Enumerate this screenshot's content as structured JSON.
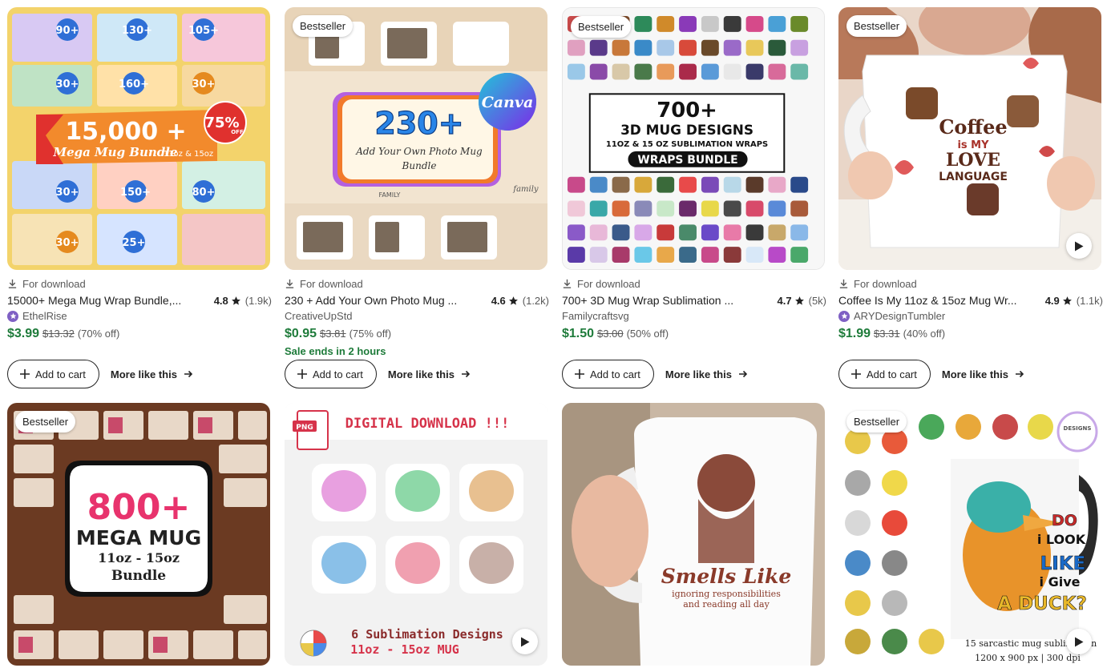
{
  "listings": [
    {
      "download_label": "For download",
      "title": "15000+ Mega Mug Wrap Bundle,...",
      "rating": "4.8",
      "reviews": "(1.9k)",
      "shop": "EthelRise",
      "star_seller": true,
      "price": "$3.99",
      "original_price": "$13.32",
      "discount": "(70% off)",
      "cart_label": "Add to cart",
      "more_label": "More like this",
      "art": {
        "headline": "15,000 +",
        "sub": "Mega Mug Bundle",
        "size": "11oz & 15oz",
        "stamp": "75%",
        "stamp_sub": "OFF",
        "tiles": [
          "90+",
          "130+",
          "105+",
          "30+",
          "160+",
          "30+",
          "30+",
          "150+",
          "80+",
          "30+",
          "25+"
        ]
      }
    },
    {
      "badge": "Bestseller",
      "download_label": "For download",
      "title": "230 + Add Your Own Photo Mug ...",
      "rating": "4.6",
      "reviews": "(1.2k)",
      "shop": "CreativeUpStd",
      "star_seller": false,
      "price": "$0.95",
      "original_price": "$3.81",
      "discount": "(75% off)",
      "sale_note": "Sale ends in 2 hours",
      "cart_label": "Add to cart",
      "more_label": "More like this",
      "art": {
        "headline": "230+",
        "line1": "Add Your Own Photo Mug",
        "line2": "Bundle",
        "logo": "Canva",
        "mug_word": "FAMILY",
        "mug_script": "family"
      }
    },
    {
      "badge": "Bestseller",
      "download_label": "For download",
      "title": "700+ 3D Mug Wrap Sublimation ...",
      "rating": "4.7",
      "reviews": "(5k)",
      "shop": "Familycraftsvg",
      "star_seller": false,
      "price": "$1.50",
      "original_price": "$3.00",
      "discount": "(50% off)",
      "cart_label": "Add to cart",
      "more_label": "More like this",
      "art": {
        "headline": "700+",
        "line1": "3D MUG DESIGNS",
        "line2": "11OZ & 15 OZ SUBLIMATION WRAPS",
        "line3": "WRAPS BUNDLE"
      }
    },
    {
      "badge": "Bestseller",
      "download_label": "For download",
      "title": "Coffee Is My 11oz & 15oz Mug Wr...",
      "rating": "4.9",
      "reviews": "(1.1k)",
      "shop": "ARYDesignTumbler",
      "star_seller": true,
      "price": "$1.99",
      "original_price": "$3.31",
      "discount": "(40% off)",
      "cart_label": "Add to cart",
      "more_label": "More like this",
      "video": true,
      "art": {
        "line1": "Coffee",
        "line2": "is MY",
        "line3": "LOVE",
        "line4": "LANGUAGE"
      }
    },
    {
      "badge": "Bestseller",
      "art": {
        "headline": "800+",
        "line1": "MEGA MUG",
        "line2": "11oz - 15oz",
        "line3": "Bundle"
      }
    },
    {
      "art": {
        "header": "DIGITAL DOWNLOAD !!!",
        "file": "PNG",
        "line1": "6 Sublimation Designs",
        "line2": "11oz - 15oz MUG"
      },
      "video": true
    },
    {
      "art": {
        "line1": "Smells Like",
        "line2": "ignoring responsibilities",
        "line3": "and reading all day"
      }
    },
    {
      "badge": "Bestseller",
      "video": true,
      "art": {
        "line1": "DO",
        "line2": "i LOOK",
        "line3": "LIKE",
        "line4": "i Give",
        "line5": "A DUCK?",
        "caption1": "15 sarcastic mug sublimation",
        "caption2": "1200 x 900 px | 300 dpi",
        "logo": "DESIGNS"
      }
    }
  ],
  "colors": {
    "price": "#1e7b3a",
    "star_seller": "#7f60c4",
    "text": "#222222",
    "muted": "#595959"
  }
}
